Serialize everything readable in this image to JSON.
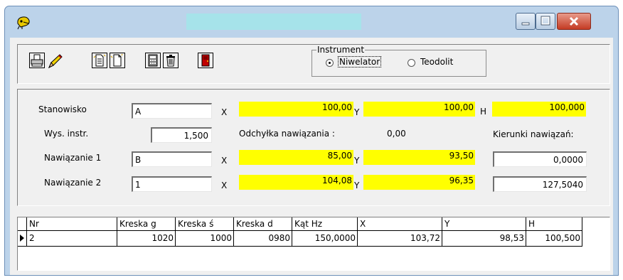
{
  "window": {
    "title": "",
    "controls": {
      "minimize_icon": "minimize-icon",
      "maximize_icon": "maximize-icon",
      "close_icon": "close-icon"
    }
  },
  "toolbar": {
    "buttons": [
      {
        "name": "print-button",
        "icon": "printer-icon"
      },
      {
        "name": "edit-button",
        "icon": "pencil-icon"
      },
      {
        "name": "copy-button",
        "icon": "copy-document-icon"
      },
      {
        "name": "new-button",
        "icon": "new-document-icon"
      },
      {
        "name": "calculator-button",
        "icon": "calculator-icon"
      },
      {
        "name": "delete-button",
        "icon": "trash-icon"
      },
      {
        "name": "exit-button",
        "icon": "exit-door-icon"
      }
    ]
  },
  "instrument": {
    "group_title": "Instrument",
    "options": [
      "Niwelator",
      "Teodolit"
    ],
    "selected": "Niwelator"
  },
  "form": {
    "stanowisko": {
      "label": "Stanowisko",
      "value": "A",
      "x": "100,00",
      "y": "100,00",
      "h": "100,000"
    },
    "wys_instr": {
      "label": "Wys. instr.",
      "value": "1,500"
    },
    "odchylka": {
      "label": "Odchyłka nawiązania :",
      "value": "0,00"
    },
    "kierunki_label": "Kierunki nawiązań:",
    "nawiazanie1": {
      "label": "Nawiązanie 1",
      "value": "B",
      "x": "85,00",
      "y": "93,50",
      "kierunek": "0,0000"
    },
    "nawiazanie2": {
      "label": "Nawiązanie 2",
      "value": "1",
      "x": "104,08",
      "y": "96,35",
      "kierunek": "127,5040"
    },
    "coord_labels": {
      "x": "X",
      "y": "Y",
      "h": "H"
    }
  },
  "table": {
    "columns": [
      "Nr",
      "Kreska g",
      "Kreska ś",
      "Kreska d",
      "Kąt Hz",
      "X",
      "Y",
      "H"
    ],
    "rows": [
      [
        "2",
        "1020",
        "1000",
        "0980",
        "150,0000",
        "103,72",
        "98,53",
        "100,500"
      ]
    ]
  },
  "colors": {
    "highlight": "#ffff00",
    "title_field": "#a6e3ea",
    "frame": "#bcd3ea"
  }
}
